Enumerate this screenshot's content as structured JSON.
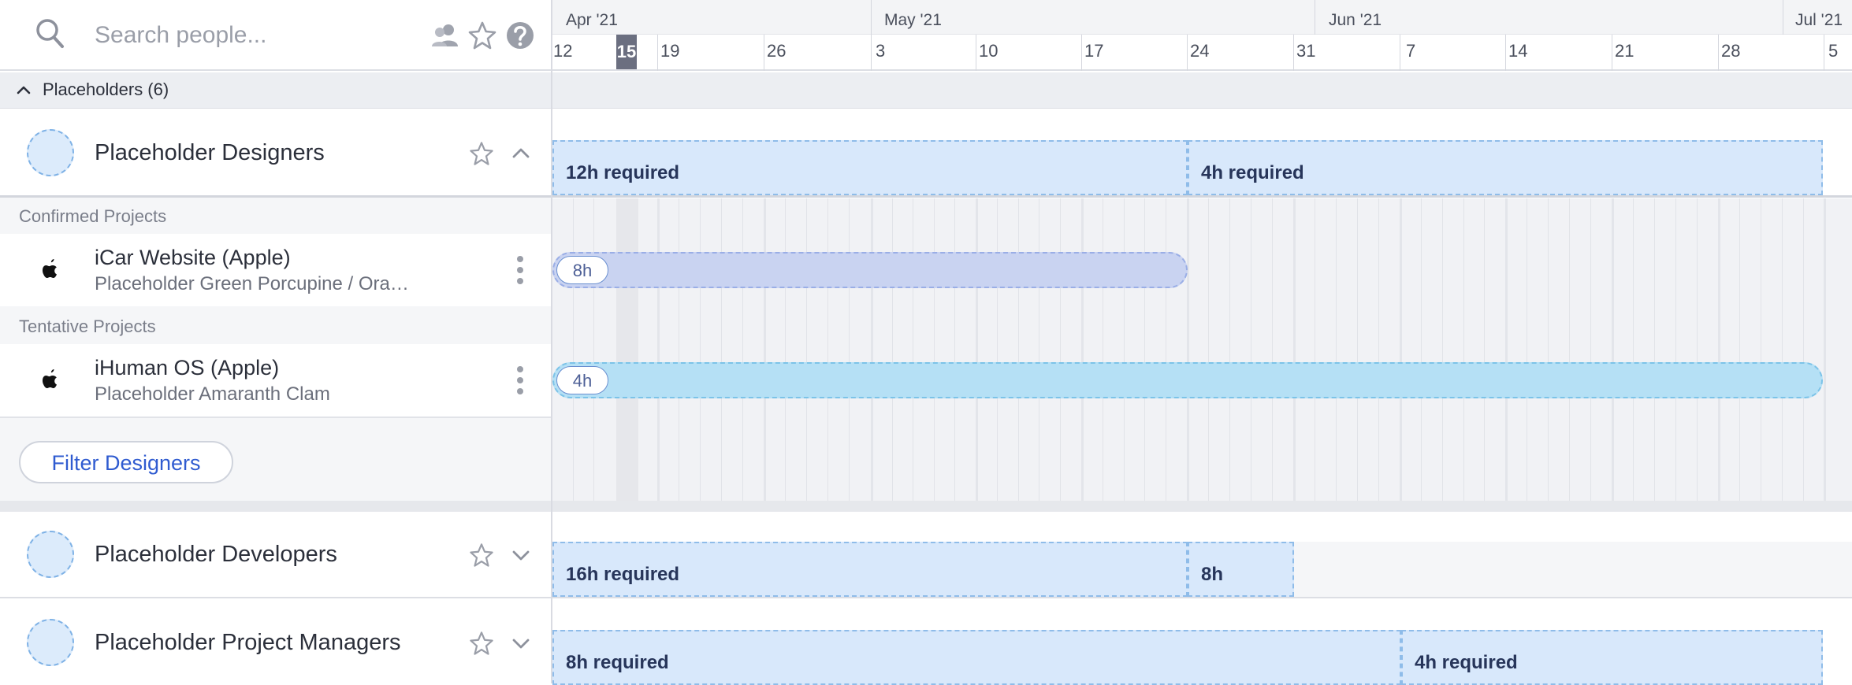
{
  "search": {
    "placeholder": "Search people..."
  },
  "header_icons": [
    "people-icon",
    "star-icon",
    "help-icon"
  ],
  "timeline": {
    "months": [
      "Apr '21",
      "May '21",
      "Jun '21",
      "Jul '21"
    ],
    "weeks": [
      "12",
      "15",
      "19",
      "26",
      "3",
      "10",
      "17",
      "24",
      "31",
      "7",
      "14",
      "21",
      "28",
      "5"
    ],
    "today": "15"
  },
  "group": {
    "label": "Placeholders (6)"
  },
  "designers": {
    "title": "Placeholder Designers",
    "requirements": [
      "12h required",
      "4h required"
    ],
    "confirmed_label": "Confirmed Projects",
    "tentative_label": "Tentative Projects",
    "confirmed_project": {
      "title": "iCar Website (Apple)",
      "subtitle": "Placeholder Green Porcupine / Ora…",
      "hours": "8h"
    },
    "tentative_project": {
      "title": "iHuman OS (Apple)",
      "subtitle": "Placeholder Amaranth Clam",
      "hours": "4h"
    },
    "filter_button": "Filter Designers"
  },
  "developers": {
    "title": "Placeholder Developers",
    "requirements": [
      "16h required",
      "8h"
    ]
  },
  "project_managers": {
    "title": "Placeholder Project Managers",
    "requirements": [
      "8h required",
      "4h required"
    ]
  },
  "colors": {
    "requirement_fill": "#d8e8fb",
    "confirmed_fill": "#c9d3f1",
    "tentative_fill": "#b5e0f5",
    "accent": "#2f5bd0"
  }
}
